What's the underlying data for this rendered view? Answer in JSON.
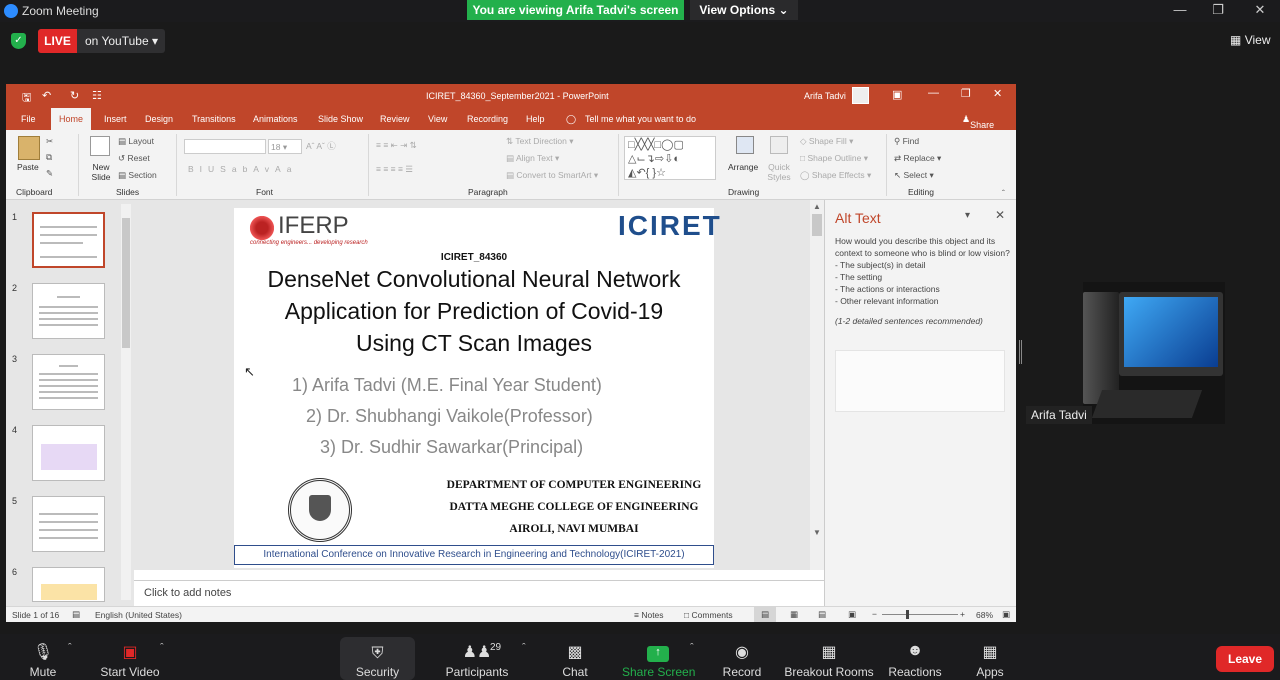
{
  "zoom": {
    "window_title": "Zoom Meeting",
    "viewing_banner": "You are viewing Arifa Tadvi's screen",
    "view_options": "View Options",
    "live_tag": "LIVE",
    "live_platform": "on YouTube",
    "view_label": "View",
    "participant_name": "Arifa Tadvi",
    "participants_count": "29",
    "leave_label": "Leave",
    "toolbar": [
      {
        "label": "Mute",
        "icon": "microphone-icon"
      },
      {
        "label": "Start Video",
        "icon": "video-off-icon"
      },
      {
        "label": "Security",
        "icon": "shield-icon"
      },
      {
        "label": "Participants",
        "icon": "participants-icon"
      },
      {
        "label": "Chat",
        "icon": "chat-icon"
      },
      {
        "label": "Share Screen",
        "icon": "share-screen-icon"
      },
      {
        "label": "Record",
        "icon": "record-icon"
      },
      {
        "label": "Breakout Rooms",
        "icon": "breakout-rooms-icon"
      },
      {
        "label": "Reactions",
        "icon": "reactions-icon"
      },
      {
        "label": "Apps",
        "icon": "apps-icon"
      }
    ]
  },
  "ppt": {
    "title": "ICIRET_84360_September2021  -  PowerPoint",
    "user": "Arifa Tadvi",
    "tabs": [
      "File",
      "Home",
      "Insert",
      "Design",
      "Transitions",
      "Animations",
      "Slide Show",
      "Review",
      "View",
      "Recording",
      "Help"
    ],
    "tell_me": "Tell me what you want to do",
    "share": "Share",
    "ribbon": {
      "clipboard": "Clipboard",
      "paste": "Paste",
      "slides": "Slides",
      "new_slide": "New Slide",
      "layout": "Layout",
      "reset": "Reset",
      "section": "Section",
      "font": "Font",
      "font_size": "18",
      "paragraph": "Paragraph",
      "text_direction": "Text Direction",
      "align_text": "Align Text",
      "convert_smartart": "Convert to SmartArt",
      "drawing": "Drawing",
      "arrange": "Arrange",
      "quick_styles": "Quick Styles",
      "shape_fill": "Shape Fill",
      "shape_outline": "Shape Outline",
      "shape_effects": "Shape Effects",
      "editing": "Editing",
      "find": "Find",
      "replace": "Replace",
      "select": "Select"
    },
    "thumb_numbers": [
      "1",
      "2",
      "3",
      "4",
      "5",
      "6"
    ],
    "slide": {
      "logo_left": "IFERP",
      "logo_left_tag": "connecting engineers... developing research",
      "logo_right": "ICIRET",
      "code": "ICIRET_84360",
      "title_line1": "DenseNet Convolutional Neural Network",
      "title_line2": "Application for Prediction of Covid-19",
      "title_line3": "Using CT Scan Images",
      "author1": "1)  Arifa Tadvi (M.E. Final Year Student)",
      "author2": "2)  Dr. Shubhangi Vaikole(Professor)",
      "author3": "3) Dr. Sudhir Sawarkar(Principal)",
      "dept1": "DEPARTMENT OF COMPUTER ENGINEERING",
      "dept2": "DATTA MEGHE COLLEGE OF ENGINEERING",
      "dept3": "AIROLI, NAVI MUMBAI",
      "footer": "International Conference on Innovative Research in Engineering and Technology(ICIRET-2021)"
    },
    "notes_placeholder": "Click to add notes",
    "alt_text": {
      "title": "Alt Text",
      "desc": "How would you describe this object and its context to someone who is blind or low vision?",
      "items": [
        "- The subject(s) in detail",
        "- The setting",
        "- The actions or interactions",
        "- Other relevant information"
      ],
      "hint": "(1-2 detailed sentences recommended)"
    },
    "status": {
      "slide": "Slide 1 of 16",
      "language": "English (United States)",
      "notes": "Notes",
      "comments": "Comments",
      "zoom": "68%"
    }
  }
}
